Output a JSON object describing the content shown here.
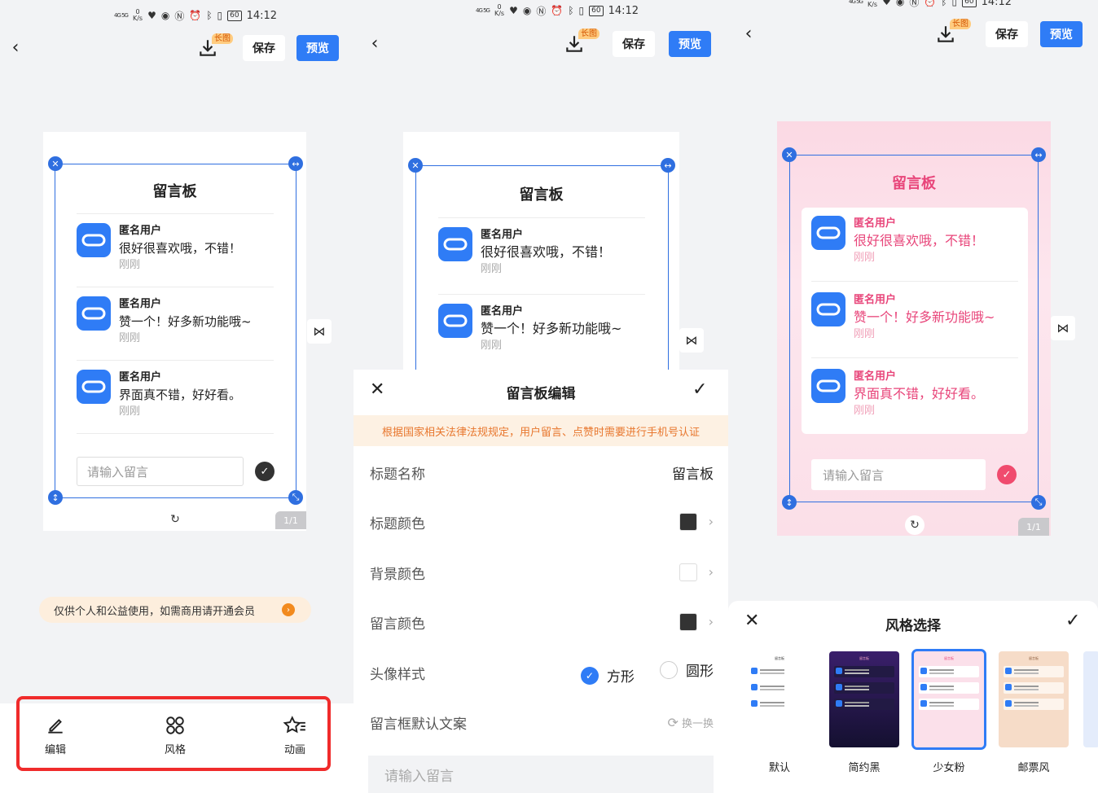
{
  "status": {
    "network": "4G 5G",
    "speed_value": "0",
    "speed_unit": "K/s",
    "battery": "60",
    "time": "14:12"
  },
  "topbar": {
    "long_tag": "长图",
    "save_label": "保存",
    "preview_label": "预览"
  },
  "board": {
    "title": "留言板",
    "messages": [
      {
        "name": "匿名用户",
        "text": "很好很喜欢哦，不错！",
        "time": "刚刚"
      },
      {
        "name": "匿名用户",
        "text": "赞一个！好多新功能哦~",
        "time": "刚刚"
      },
      {
        "name": "匿名用户",
        "text": "界面真不错，好好看。",
        "time": "刚刚"
      }
    ],
    "input_placeholder": "请输入留言",
    "page_indicator": "1/1"
  },
  "panel1": {
    "notice": "仅供个人和公益使用，如需商用请开通会员",
    "tools": [
      {
        "label": "编辑",
        "icon": "pencil-icon"
      },
      {
        "label": "风格",
        "icon": "grid-icon"
      },
      {
        "label": "动画",
        "icon": "star-animation-icon"
      }
    ]
  },
  "panel2": {
    "sheet_title": "留言板编辑",
    "warning": "根据国家相关法律法规规定，用户留言、点赞时需要进行手机号认证",
    "rows": {
      "title_name_label": "标题名称",
      "title_name_value": "留言板",
      "title_color_label": "标题颜色",
      "bg_color_label": "背景颜色",
      "msg_color_label": "留言颜色",
      "avatar_style_label": "头像样式",
      "avatar_square": "方形",
      "avatar_round": "圆形",
      "default_text_label": "留言框默认文案",
      "swap_label": "换一换"
    },
    "colors": {
      "title_color": "#333333",
      "bg_color": "#ffffff",
      "msg_color": "#333333"
    },
    "field_placeholder": "请输入留言"
  },
  "panel3": {
    "sheet_title": "风格选择",
    "styles": [
      {
        "label": "默认"
      },
      {
        "label": "简约黑"
      },
      {
        "label": "少女粉"
      },
      {
        "label": "邮票风"
      }
    ]
  },
  "colors": {
    "accent": "#2f7cf6",
    "pink": "#e8457a",
    "highlight_red": "#f02b2b"
  }
}
